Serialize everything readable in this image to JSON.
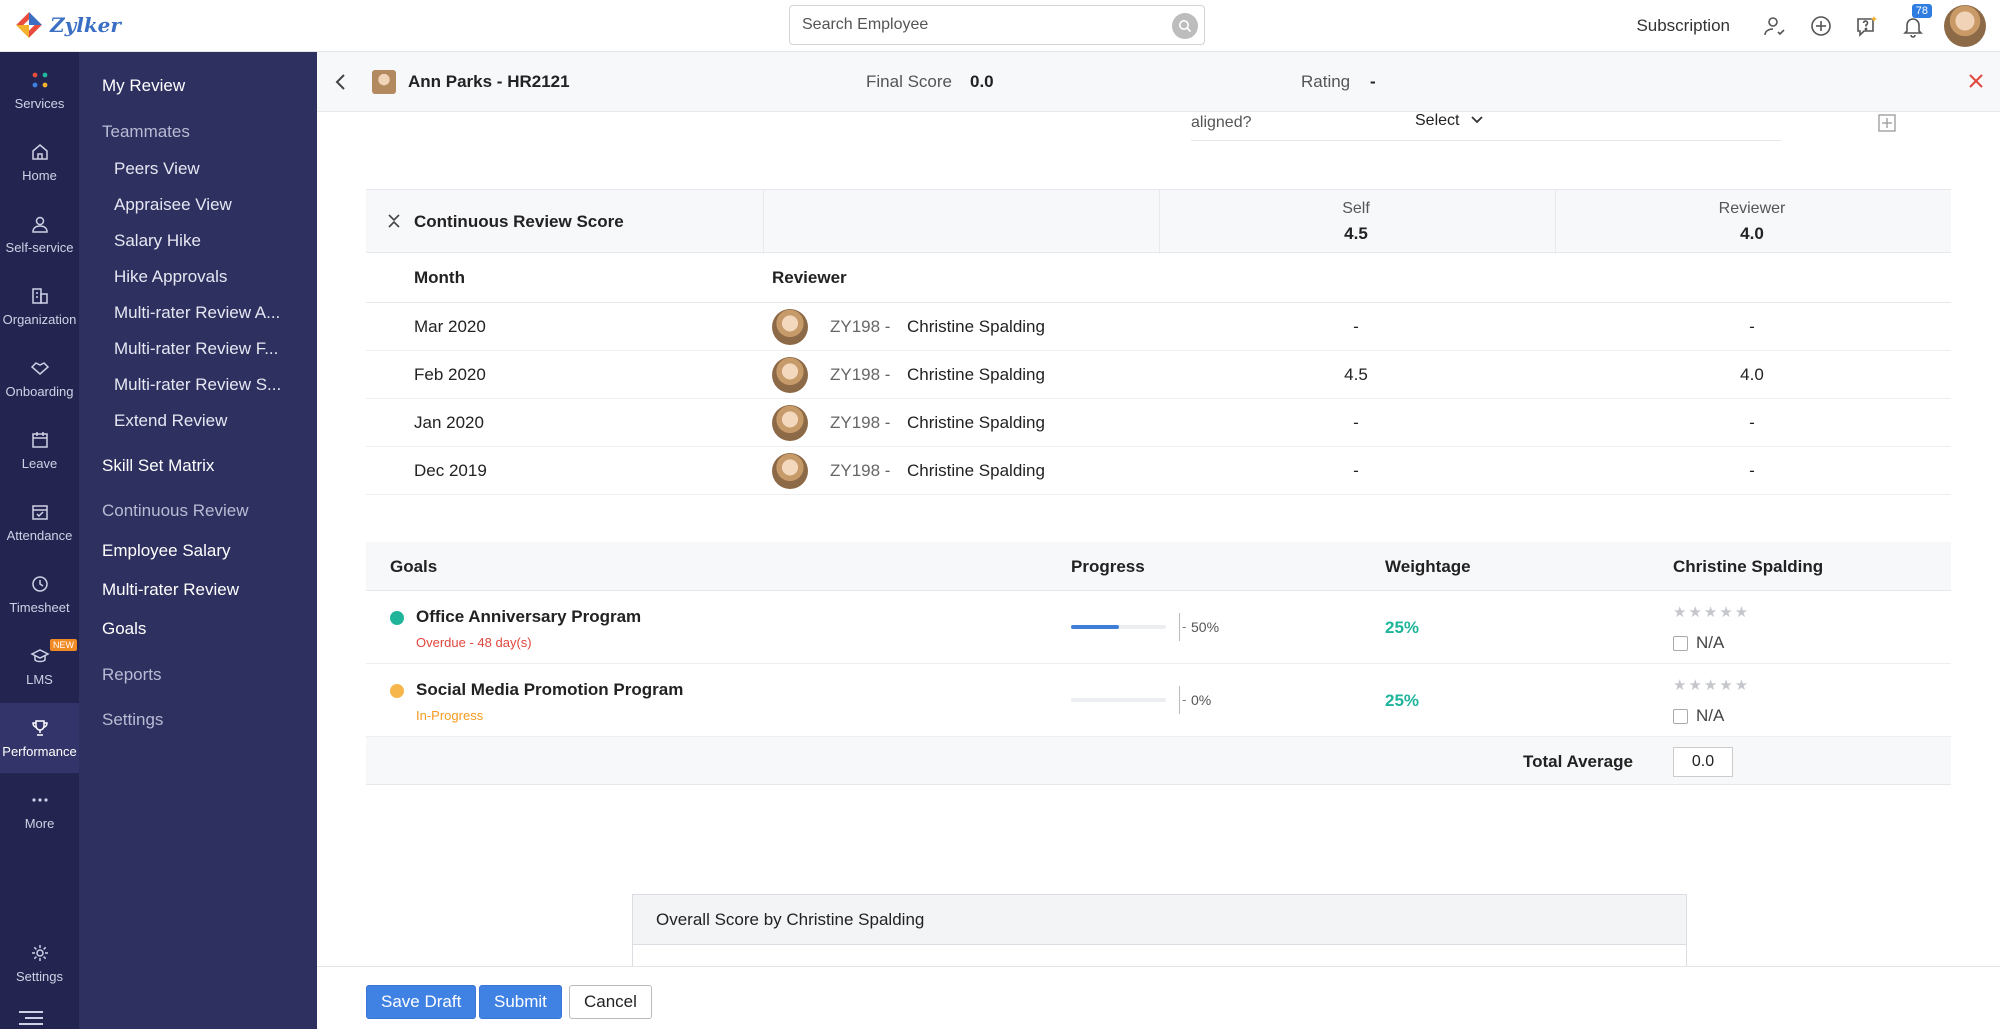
{
  "app": {
    "logo_text": "Zylker"
  },
  "topbar": {
    "search_placeholder": "Search Employee",
    "subscription_label": "Subscription",
    "notifications_count": "78"
  },
  "rail": [
    {
      "label": "Services",
      "icon": "services-grid-icon"
    },
    {
      "label": "Home",
      "icon": "home-icon"
    },
    {
      "label": "Self-service",
      "icon": "person-icon"
    },
    {
      "label": "Organization",
      "icon": "building-icon"
    },
    {
      "label": "Onboarding",
      "icon": "handshake-icon"
    },
    {
      "label": "Leave",
      "icon": "calendar-icon"
    },
    {
      "label": "Attendance",
      "icon": "calendar-check-icon"
    },
    {
      "label": "Timesheet",
      "icon": "clock-icon"
    },
    {
      "label": "LMS",
      "icon": "graduation-cap-icon",
      "tag": "NEW"
    },
    {
      "label": "Performance",
      "icon": "trophy-icon"
    },
    {
      "label": "More",
      "icon": "more-dots-icon"
    },
    {
      "label": "Settings",
      "icon": "gear-icon"
    }
  ],
  "subnav": {
    "my_review": "My Review",
    "teammates": "Teammates",
    "peers_view": "Peers View",
    "appraisee_view": "Appraisee View",
    "salary_hike": "Salary Hike",
    "hike_approvals": "Hike Approvals",
    "mrr_a": "Multi-rater Review A...",
    "mrr_f": "Multi-rater Review F...",
    "mrr_s": "Multi-rater Review S...",
    "extend_review": "Extend Review",
    "skill_set": "Skill Set Matrix",
    "continuous_review": "Continuous Review",
    "employee_salary": "Employee Salary",
    "multi_rater_review": "Multi-rater Review",
    "goals": "Goals",
    "reports": "Reports",
    "settings": "Settings"
  },
  "header": {
    "employee": "Ann Parks - HR2121",
    "final_score_label": "Final Score",
    "final_score": "0.0",
    "rating_label": "Rating",
    "rating": "-"
  },
  "aligned": {
    "text": "aligned?",
    "select": "Select"
  },
  "continuous_review": {
    "title": "Continuous Review Score",
    "self_label": "Self",
    "self_score": "4.5",
    "reviewer_label": "Reviewer",
    "reviewer_score": "4.0",
    "col_month": "Month",
    "col_reviewer": "Reviewer",
    "rows": [
      {
        "month": "Mar 2020",
        "reviewer_id": "ZY198 -",
        "reviewer_name": "Christine Spalding",
        "self": "-",
        "reviewer": "-"
      },
      {
        "month": "Feb 2020",
        "reviewer_id": "ZY198 -",
        "reviewer_name": "Christine Spalding",
        "self": "4.5",
        "reviewer": "4.0"
      },
      {
        "month": "Jan 2020",
        "reviewer_id": "ZY198 -",
        "reviewer_name": "Christine Spalding",
        "self": "-",
        "reviewer": "-"
      },
      {
        "month": "Dec 2019",
        "reviewer_id": "ZY198 -",
        "reviewer_name": "Christine Spalding",
        "self": "-",
        "reviewer": "-"
      }
    ]
  },
  "goals": {
    "col_goals": "Goals",
    "col_progress": "Progress",
    "col_weightage": "Weightage",
    "col_rater": "Christine Spalding",
    "items": [
      {
        "title": "Office Anniversary Program",
        "status": "Overdue - 48 day(s)",
        "status_color": "#e0473e",
        "dot_color": "#1fb59a",
        "progress_label": "50%",
        "progress": 0.5,
        "weightage": "25%",
        "na": "N/A"
      },
      {
        "title": "Social Media Promotion Program",
        "status": "In-Progress",
        "status_color": "#f59b1e",
        "dot_color": "#f7b64b",
        "progress_label": "0%",
        "progress": 0,
        "weightage": "25%",
        "na": "N/A"
      }
    ],
    "total_label": "Total Average",
    "total_value": "0.0"
  },
  "overall": {
    "title": "Overall Score by Christine Spalding"
  },
  "footer": {
    "save_draft": "Save Draft",
    "submit": "Submit",
    "cancel": "Cancel"
  }
}
